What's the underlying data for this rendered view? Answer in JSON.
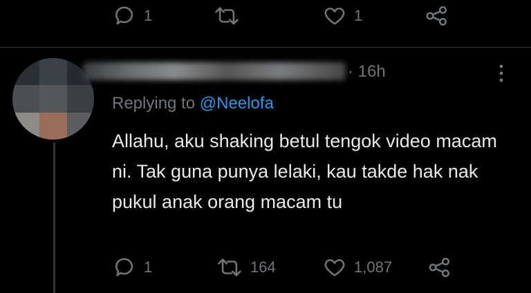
{
  "prev_tweet_actions": {
    "reply_count": "1",
    "retweet_count": "",
    "like_count": "1"
  },
  "tweet": {
    "time": "· 16h",
    "replying_prefix": "Replying to ",
    "replying_handle": "@Neelofa",
    "text": "Allahu, aku shaking betul tengok video macam ni. Tak guna punya lelaki, kau takde hak nak pukul anak orang macam tu",
    "reply_count": "1",
    "retweet_count": "164",
    "like_count": "1,087"
  },
  "colors": {
    "background": "#000000",
    "text": "#e7e9ea",
    "muted": "#71767b",
    "accent": "#1d9bf0",
    "divider": "#2f3336"
  },
  "icons": [
    "reply-icon",
    "retweet-icon",
    "like-icon",
    "share-icon",
    "more-icon"
  ]
}
